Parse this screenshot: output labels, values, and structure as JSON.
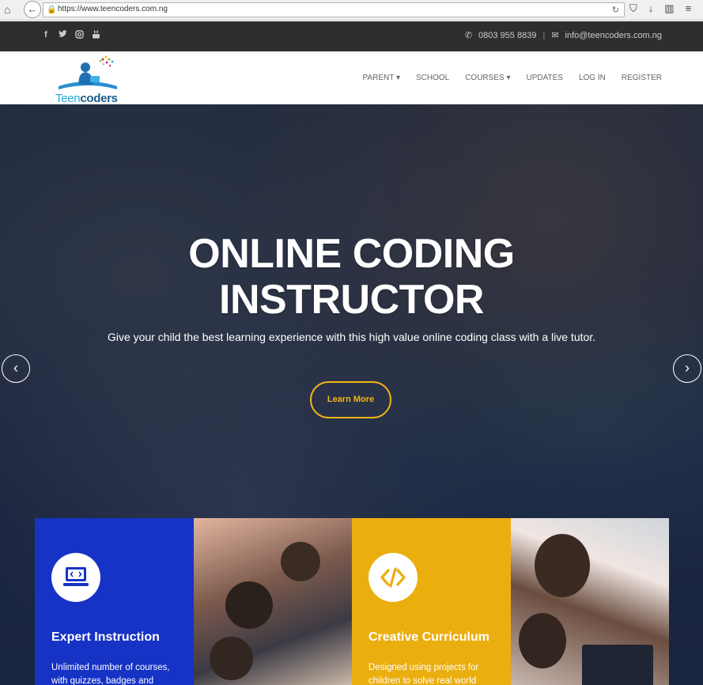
{
  "browser": {
    "url": "https://www.teencoders.com.ng"
  },
  "topbar": {
    "social": [
      "f",
      "t",
      "ig",
      "yt"
    ],
    "phone": "0803 955 8839",
    "separator": "|",
    "email": "info@teencoders.com.ng"
  },
  "header": {
    "logo_text_teen": "Teen",
    "logo_text_coders": "coders",
    "nav": [
      "PARENT",
      "SCHOOL",
      "COURSES",
      "UPDATES",
      "LOG IN",
      "REGISTER"
    ]
  },
  "hero": {
    "title_line1": "ONLINE CODING",
    "title_line2": "INSTRUCTOR",
    "subtitle": "Give your child the best learning experience with this high value online coding class with a live tutor.",
    "cta": "Learn More"
  },
  "features": [
    {
      "title": "Expert Instruction",
      "text": "Unlimited number of courses, with quizzes, badges and"
    },
    {
      "title": "Creative Curriculum",
      "text": "Designed using projects for children to solve real world"
    }
  ],
  "colors": {
    "accent": "#f2b416",
    "blue": "#1633c6",
    "yellow": "#ebae0f",
    "topbar": "#2e2e2e"
  }
}
